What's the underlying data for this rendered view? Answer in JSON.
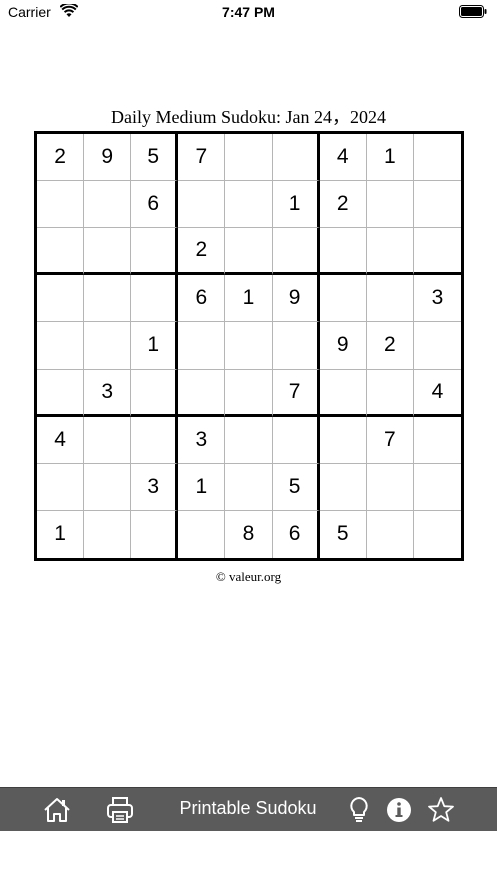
{
  "status_bar": {
    "carrier": "Carrier",
    "time": "7:47 PM"
  },
  "puzzle": {
    "title": "Daily Medium Sudoku: Jan 24，2024",
    "copyright": "© valeur.org",
    "grid": [
      [
        "2",
        "9",
        "5",
        "7",
        "",
        "",
        "4",
        "1",
        ""
      ],
      [
        "",
        "",
        "6",
        "",
        "",
        "1",
        "2",
        "",
        ""
      ],
      [
        "",
        "",
        "",
        "2",
        "",
        "",
        "",
        "",
        ""
      ],
      [
        "",
        "",
        "",
        "6",
        "1",
        "9",
        "",
        "",
        "3"
      ],
      [
        "",
        "",
        "1",
        "",
        "",
        "",
        "9",
        "2",
        ""
      ],
      [
        "",
        "3",
        "",
        "",
        "",
        "7",
        "",
        "",
        "4"
      ],
      [
        "4",
        "",
        "",
        "3",
        "",
        "",
        "",
        "7",
        ""
      ],
      [
        "",
        "",
        "3",
        "1",
        "",
        "5",
        "",
        "",
        ""
      ],
      [
        "1",
        "",
        "",
        "",
        "8",
        "6",
        "5",
        "",
        ""
      ]
    ]
  },
  "toolbar": {
    "label": "Printable Sudoku",
    "icons": [
      "home-icon",
      "print-icon",
      "lightbulb-icon",
      "info-icon",
      "star-icon"
    ],
    "background": "#5b5b5b"
  }
}
